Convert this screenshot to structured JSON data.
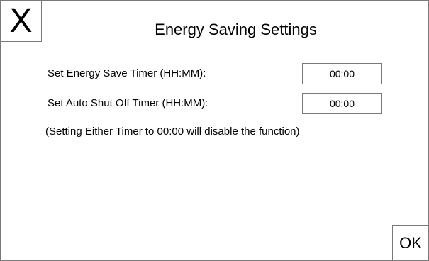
{
  "header": {
    "close_label": "X",
    "title": "Energy Saving Settings"
  },
  "settings": {
    "energy_save_timer": {
      "label": "Set Energy Save Timer (HH:MM):",
      "value": "00:00"
    },
    "auto_shut_off_timer": {
      "label": "Set Auto Shut Off Timer (HH:MM):",
      "value": "00:00"
    },
    "note": "(Setting Either Timer to 00:00 will disable the function)"
  },
  "footer": {
    "ok_label": "OK"
  }
}
